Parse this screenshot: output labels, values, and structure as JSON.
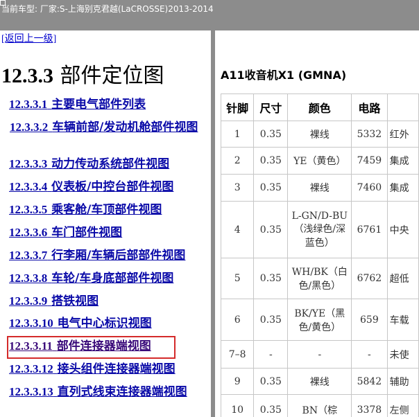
{
  "header": {
    "caption": "当前车型:   厂家:S-上海别克君越(LaCROSSE)2013-2014"
  },
  "left": {
    "back_link": "[返回上一级]",
    "title_num": "12.3.3",
    "title_text": "部件定位图",
    "toc": [
      {
        "num": "12.3.3.1",
        "label": "主要电气部件列表"
      },
      {
        "num": "12.3.3.2",
        "label": "车辆前部/发动机舱部件视图"
      },
      {
        "num": "12.3.3.3",
        "label": "动力传动系统部件视图"
      },
      {
        "num": "12.3.3.4",
        "label": "仪表板/中控台部件视图"
      },
      {
        "num": "12.3.3.5",
        "label": "乘客舱/车顶部件视图"
      },
      {
        "num": "12.3.3.6",
        "label": "车门部件视图"
      },
      {
        "num": "12.3.3.7",
        "label": "行李厢/车辆后部部件视图"
      },
      {
        "num": "12.3.3.8",
        "label": "车轮/车身底部部件视图"
      },
      {
        "num": "12.3.3.9",
        "label": "搭铁视图"
      },
      {
        "num": "12.3.3.10",
        "label": "电气中心标识视图"
      },
      {
        "num": "12.3.3.11",
        "label": "部件连接器端视图"
      },
      {
        "num": "12.3.3.12",
        "label": "接头组件连接器端视图"
      },
      {
        "num": "12.3.3.13",
        "label": "直列式线束连接器端视图"
      }
    ]
  },
  "right": {
    "connector_title": "A11收音机X1 (GMNA)",
    "columns": [
      "针脚",
      "尺寸",
      "颜色",
      "电路",
      ""
    ],
    "rows": [
      {
        "pin": "1",
        "size": "0.35",
        "color": "裸线",
        "circuit": "5332",
        "func": "红外"
      },
      {
        "pin": "2",
        "size": "0.35",
        "color": "YE（黄色）",
        "circuit": "7459",
        "func": "集成"
      },
      {
        "pin": "3",
        "size": "0.35",
        "color": "裸线",
        "circuit": "7460",
        "func": "集成"
      },
      {
        "pin": "4",
        "size": "0.35",
        "color": "L-GN/D-BU（浅绿色/深蓝色）",
        "circuit": "6761",
        "func": "中央"
      },
      {
        "pin": "5",
        "size": "0.35",
        "color": "WH/BK（白色/黑色）",
        "circuit": "6762",
        "func": "超低"
      },
      {
        "pin": "6",
        "size": "0.35",
        "color": "BK/YE（黑色/黄色）",
        "circuit": "659",
        "func": "车载"
      },
      {
        "pin": "7–8",
        "size": "-",
        "color": "-",
        "circuit": "-",
        "func": "未使"
      },
      {
        "pin": "9",
        "size": "0.35",
        "color": "裸线",
        "circuit": "5842",
        "func": "辅助"
      },
      {
        "pin": "10",
        "size": "0.35",
        "color": "BN（棕",
        "circuit": "3378",
        "func": "左侧"
      }
    ]
  },
  "colors": {
    "header_bg": "#8c8c8c",
    "link": "#0a0aa8",
    "selected_border": "#d42a2a"
  }
}
